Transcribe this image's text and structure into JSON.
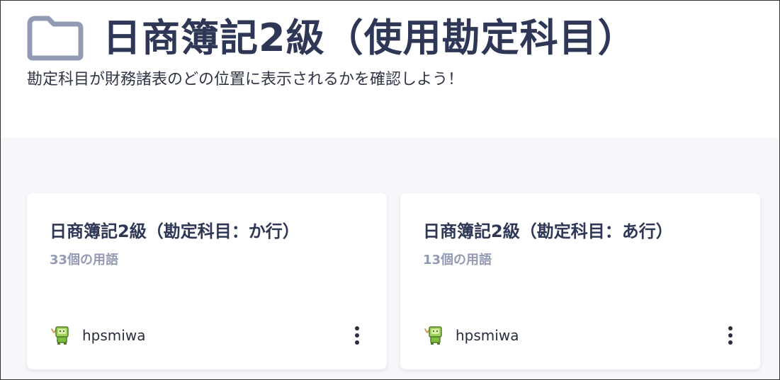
{
  "header": {
    "icon": "folder-icon",
    "title": "日商簿記2級（使用勘定科目）",
    "subtitle": "勘定科目が財務諸表のどの位置に表示されるかを確認しよう！"
  },
  "sets": [
    {
      "title": "日商簿記2級（勘定科目：か行）",
      "count": "33個の用語",
      "username": "hpsmiwa",
      "avatar": "avatar-character-icon",
      "menu_icon": "more-vertical-icon"
    },
    {
      "title": "日商簿記2級（勘定科目：あ行）",
      "count": "13個の用語",
      "username": "hpsmiwa",
      "avatar": "avatar-character-icon",
      "menu_icon": "more-vertical-icon"
    }
  ],
  "colors": {
    "title_text": "#2e3856",
    "muted_text": "#939bb4",
    "folder_icon": "#939bb4",
    "content_bg": "#f6f7fb"
  }
}
